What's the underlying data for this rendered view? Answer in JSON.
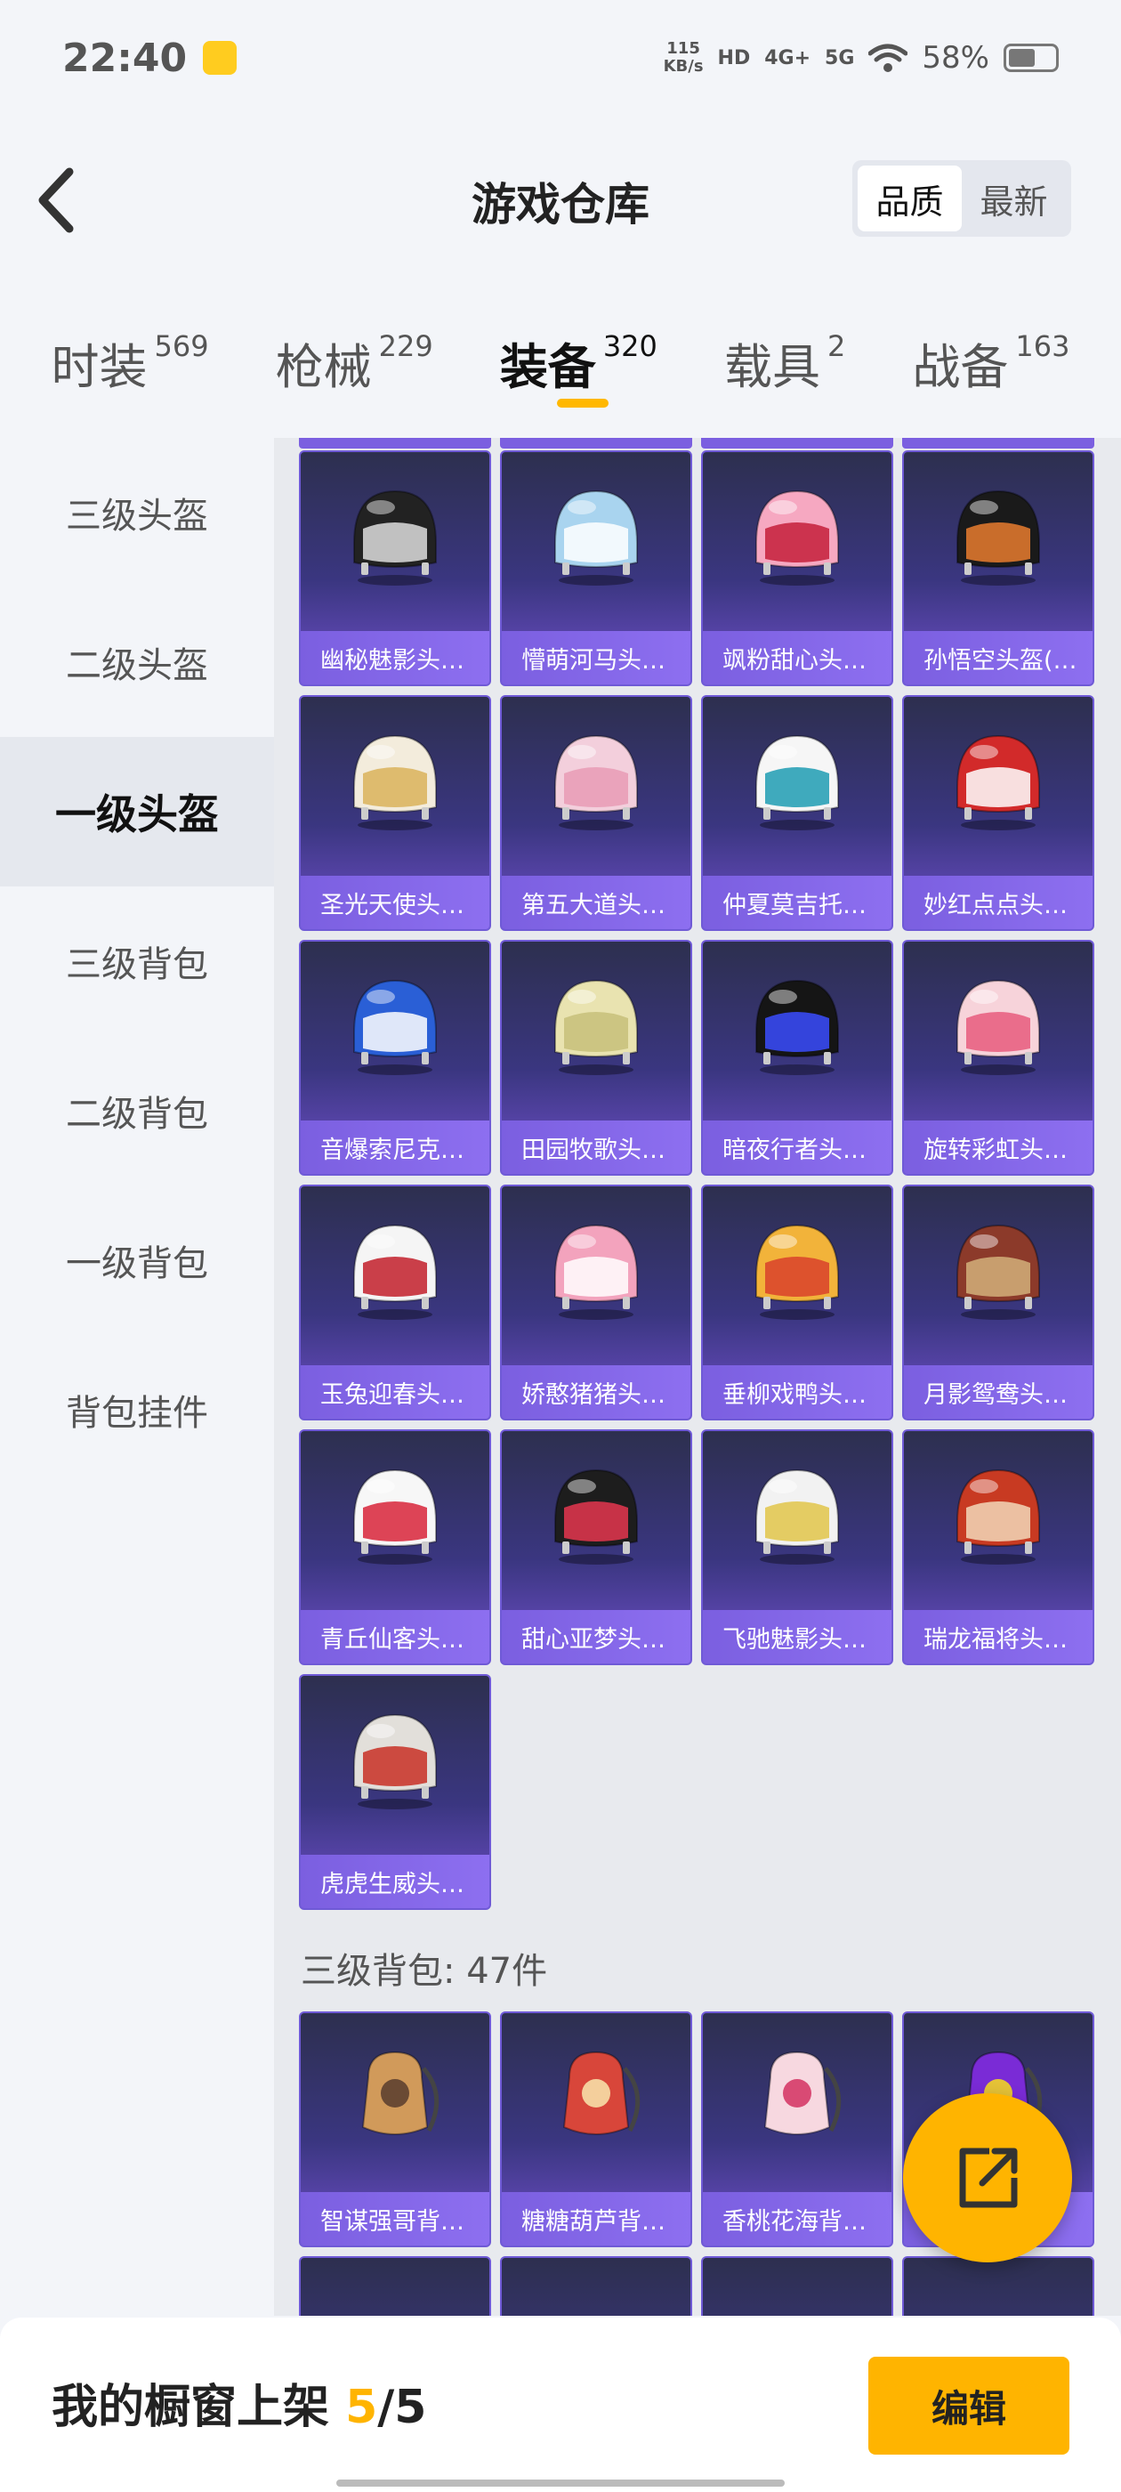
{
  "status_bar": {
    "time": "22:40",
    "speed_value": "115",
    "speed_unit": "KB/s",
    "hd_label": "HD",
    "network_4g": "4G+",
    "network_5g": "5G",
    "battery_text": "58%",
    "battery_level": 0.58
  },
  "header": {
    "title": "游戏仓库",
    "sort_quality": "品质",
    "sort_newest": "最新"
  },
  "category_tabs": [
    {
      "label": "时装",
      "count": "569"
    },
    {
      "label": "枪械",
      "count": "229"
    },
    {
      "label": "装备",
      "count": "320"
    },
    {
      "label": "载具",
      "count": "2"
    },
    {
      "label": "战备",
      "count": "163"
    }
  ],
  "sidebar": {
    "items": [
      "三级头盔",
      "二级头盔",
      "一级头盔",
      "三级背包",
      "二级背包",
      "一级背包",
      "背包挂件"
    ],
    "active": "一级头盔"
  },
  "helmets": [
    {
      "name": "幽秘魅影头…",
      "color": "#222222",
      "accent": "#dddddd"
    },
    {
      "name": "懵萌河马头…",
      "color": "#a9d4ef",
      "accent": "#ffffff"
    },
    {
      "name": "飒粉甜心头…",
      "color": "#f6a8c1",
      "accent": "#c41e3a"
    },
    {
      "name": "孙悟空头盔(…",
      "color": "#1a1a1a",
      "accent": "#e97c2f"
    },
    {
      "name": "圣光天使头…",
      "color": "#f3ecdc",
      "accent": "#d9b35a"
    },
    {
      "name": "第五大道头…",
      "color": "#f3cfdc",
      "accent": "#e79bb5"
    },
    {
      "name": "仲夏莫吉托…",
      "color": "#f6f6f6",
      "accent": "#1f9cb3"
    },
    {
      "name": "妙红点点头…",
      "color": "#d22a2a",
      "accent": "#ffffff"
    },
    {
      "name": "音爆索尼克…",
      "color": "#2a5fd6",
      "accent": "#ffffff"
    },
    {
      "name": "田园牧歌头…",
      "color": "#e9e3b0",
      "accent": "#c7bf7a"
    },
    {
      "name": "暗夜行者头…",
      "color": "#151515",
      "accent": "#3a4cff"
    },
    {
      "name": "旋转彩虹头…",
      "color": "#f7d3da",
      "accent": "#e75a7c"
    },
    {
      "name": "玉兔迎春头…",
      "color": "#f5f5f5",
      "accent": "#c21f2a"
    },
    {
      "name": "娇憨猪猪头…",
      "color": "#f3a3bd",
      "accent": "#ffffff"
    },
    {
      "name": "垂柳戏鸭头…",
      "color": "#f2b33a",
      "accent": "#d9412b"
    },
    {
      "name": "月影鸳鸯头…",
      "color": "#8c3a2a",
      "accent": "#d2b07a"
    },
    {
      "name": "青丘仙客头…",
      "color": "#f7f7f7",
      "accent": "#d8243a"
    },
    {
      "name": "甜心亚梦头…",
      "color": "#1d1d1d",
      "accent": "#e5364f"
    },
    {
      "name": "飞驰魅影头…",
      "color": "#f2f2f2",
      "accent": "#e2c64a"
    },
    {
      "name": "瑞龙福将头…",
      "color": "#c83a22",
      "accent": "#f2d8b8"
    },
    {
      "name": "虎虎生威头…",
      "color": "#e2dfda",
      "accent": "#c83024"
    }
  ],
  "backpack_section": {
    "title": "三级背包: 47件",
    "items": [
      {
        "name": "智谋强哥背…",
        "color": "#d19a5a",
        "accent": "#6a4a34"
      },
      {
        "name": "糖糖葫芦背…",
        "color": "#d8463a",
        "accent": "#f4cf9c"
      },
      {
        "name": "香桃花海背…",
        "color": "#f7d8e0",
        "accent": "#d94a74"
      },
      {
        "name": "",
        "color": "#7a2bd6",
        "accent": "#e5c237"
      }
    ]
  },
  "bottom_bar": {
    "shelf_label": "我的橱窗上架 ",
    "shelf_current": "5",
    "shelf_total": "/5",
    "edit_label": "编辑"
  }
}
